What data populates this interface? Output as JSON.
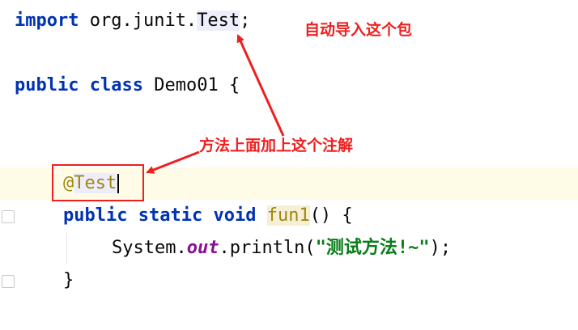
{
  "code": {
    "line1": {
      "keyword": "import",
      "package": " org.junit.",
      "class_name": "Test",
      "end": ";"
    },
    "line2": {
      "kw1": "public",
      "kw2": "class",
      "name": "Demo01",
      "brace": " {"
    },
    "line3": {
      "annotation_at": "@",
      "annotation_name": "Test"
    },
    "line4": {
      "kw1": "public",
      "kw2": "static",
      "kw3": "void",
      "method": "fun1",
      "rest": "() {"
    },
    "line5": {
      "prefix": "System.",
      "field": "out",
      "call": ".println(",
      "string": "\"测试方法!~\"",
      "end": ");"
    },
    "line6": {
      "brace": "}"
    }
  },
  "annotations": {
    "import_note": "自动导入这个包",
    "annotation_note": "方法上面加上这个注解"
  },
  "colors": {
    "keyword": "#0033b3",
    "annotation": "#9e880d",
    "string": "#067d17",
    "static_field": "#871094",
    "callout_red": "#ef1f1f",
    "caret_row": "#fefce6"
  }
}
